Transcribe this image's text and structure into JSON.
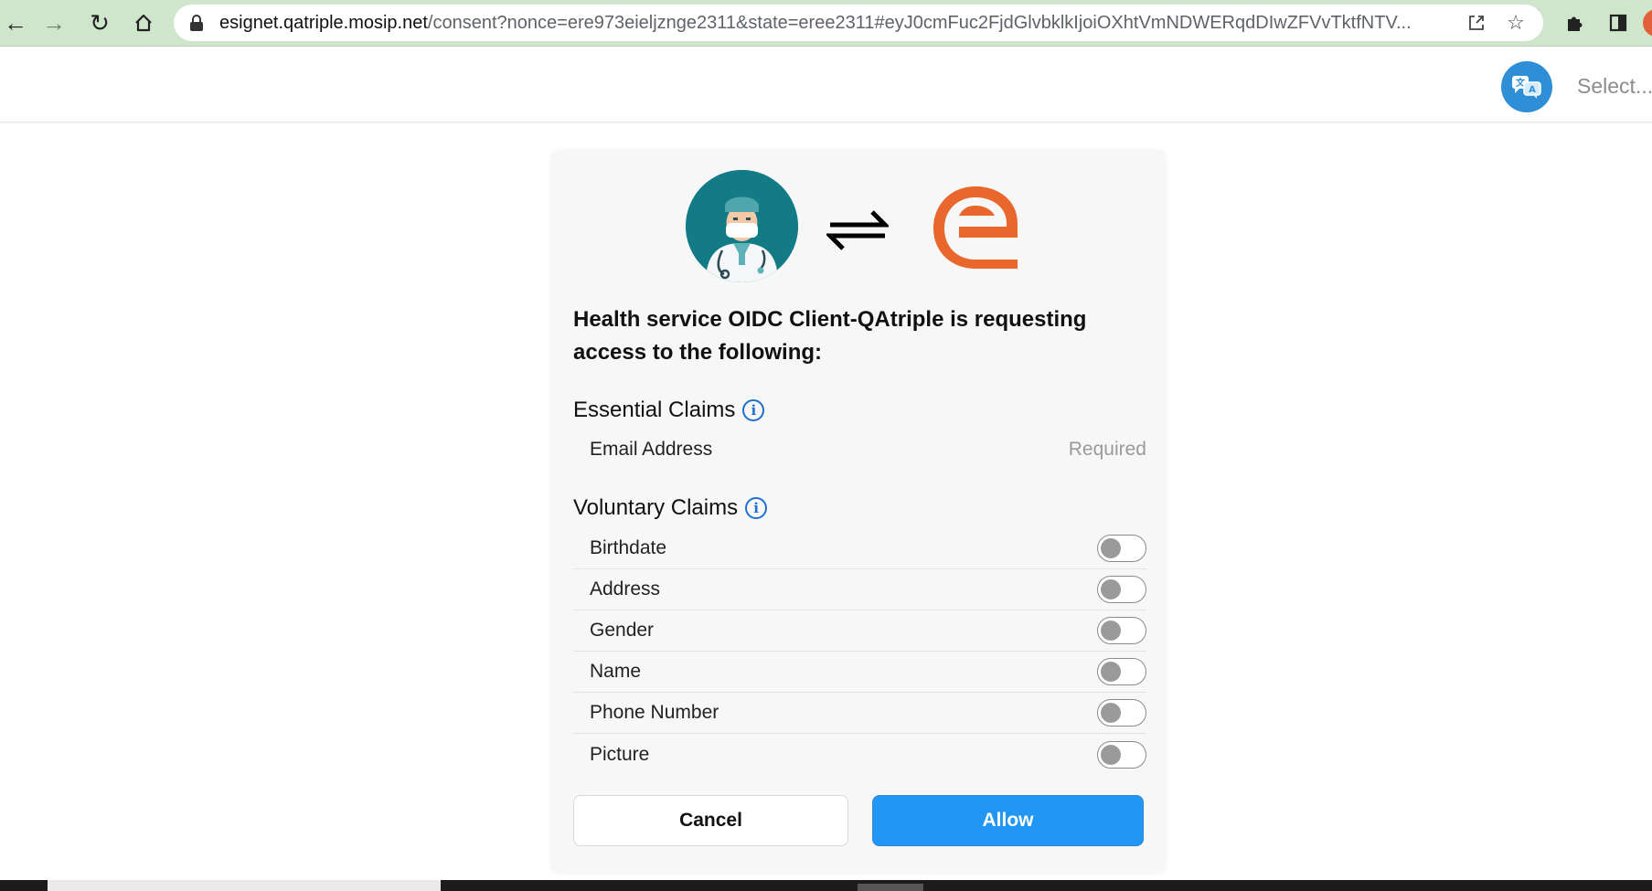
{
  "browser": {
    "url_host": "esignet.qatriple.mosip.net",
    "url_rest": "/consent?nonce=ere973eieljznge2311&state=eree2311#eyJ0cmFuc2FjdGlvbklkIjoiOXhtVmNDWERqdDIwZFVvTktfNTV...",
    "icons": [
      "back-arrow-icon",
      "forward-arrow-icon",
      "reload-icon",
      "home-icon",
      "lock-icon",
      "share-icon",
      "star-icon",
      "puzzle-icon",
      "side-panel-icon",
      "profile-icon"
    ]
  },
  "header": {
    "language_select": "Select...",
    "language_icon": "language-translate-icon"
  },
  "consent": {
    "title": "Health service OIDC Client-QAtriple is requesting access to the following:",
    "essential": {
      "heading": "Essential Claims",
      "info_glyph": "i",
      "claims": [
        {
          "label": "Email Address",
          "status": "Required"
        }
      ]
    },
    "voluntary": {
      "heading": "Voluntary Claims",
      "info_glyph": "i",
      "claims": [
        {
          "label": "Birthdate",
          "enabled": false
        },
        {
          "label": "Address",
          "enabled": false
        },
        {
          "label": "Gender",
          "enabled": false
        },
        {
          "label": "Name",
          "enabled": false
        },
        {
          "label": "Phone Number",
          "enabled": false
        },
        {
          "label": "Picture",
          "enabled": false
        }
      ]
    },
    "buttons": {
      "cancel": "Cancel",
      "allow": "Allow"
    }
  },
  "colors": {
    "browser_bar": "#cfe6cd",
    "client_logo_bg": "#127b85",
    "esignet_orange": "#e9672c",
    "info_blue": "#1f6fd0",
    "allow_blue": "#2196f3",
    "card_bg": "#f7f7f7"
  }
}
